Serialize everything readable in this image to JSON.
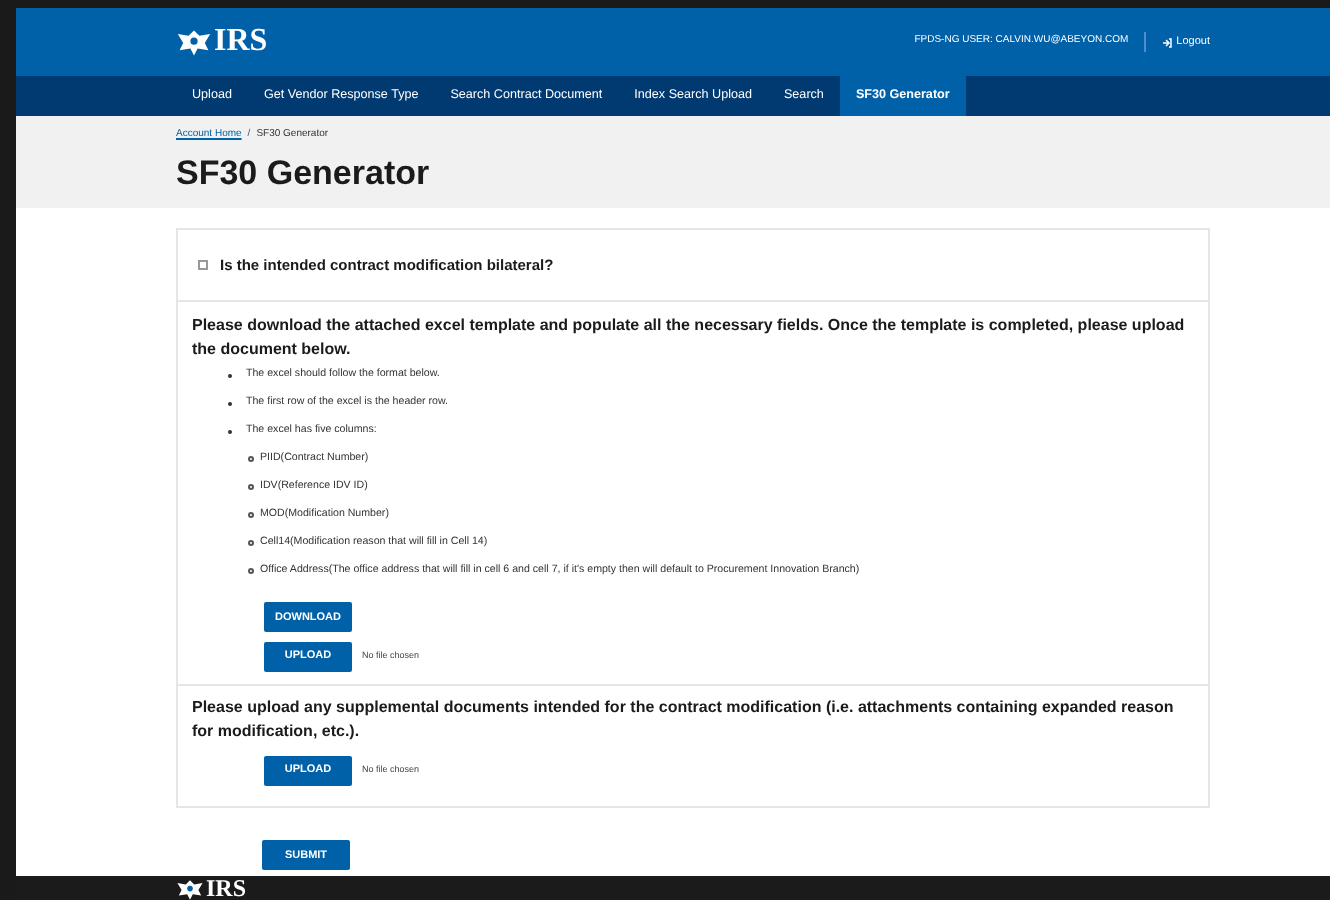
{
  "header": {
    "logo": "IRS",
    "user": "FPDS-NG USER: CALVIN.WU@ABEYON.COM",
    "logout": "Logout"
  },
  "nav": [
    {
      "label": "Upload",
      "selected": false
    },
    {
      "label": "Get Vendor Response Type",
      "selected": false
    },
    {
      "label": "Search Contract Document",
      "selected": false
    },
    {
      "label": "Index Search Upload",
      "selected": false
    },
    {
      "label": "Search",
      "selected": false
    },
    {
      "label": "SF30 Generator",
      "selected": true
    }
  ],
  "breadcrumb": {
    "link": "Account Home",
    "separator": "/",
    "current": "SF30 Generator"
  },
  "title": "SF30 Generator",
  "bilateral": {
    "label": "Is the intended contract modification bilateral?",
    "checked": false
  },
  "template": {
    "heading": "Please download the attached excel template and populate all the necessary fields. Once the template is completed, please upload the document below.",
    "bullets": [
      "The excel should follow the format below.",
      "The first row of the excel is the header row.",
      "The excel has five columns:"
    ],
    "columns": [
      "PIID(Contract Number)",
      "IDV(Reference IDV ID)",
      "MOD(Modification Number)",
      "Cell14(Modification reason that will fill in Cell 14)",
      "Office Address(The office address that will fill in cell 6 and cell 7, if it's empty then will default to Procurement Innovation Branch)"
    ],
    "download": "DOWNLOAD",
    "upload": "UPLOAD",
    "file_status": "No file chosen"
  },
  "supplemental": {
    "heading": "Please upload any supplemental documents intended for the contract modification (i.e. attachments containing expanded reason for modification, etc.).",
    "upload": "UPLOAD",
    "file_status": "No file chosen"
  },
  "submit": "SUBMIT",
  "footer": {
    "logo": "IRS"
  }
}
